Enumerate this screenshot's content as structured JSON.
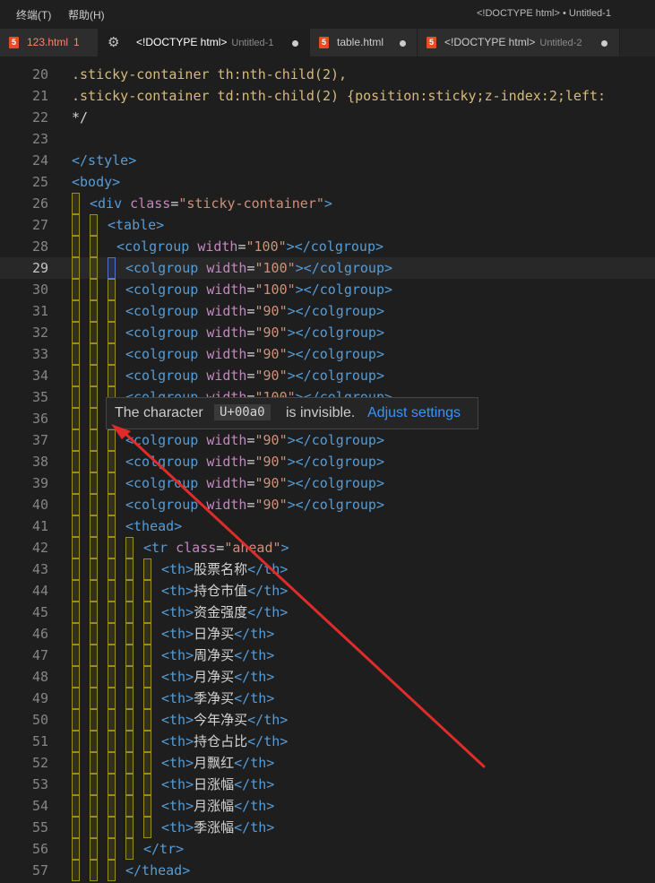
{
  "menu": [
    "终端(T)",
    "帮助(H)"
  ],
  "window_title": "<!DOCTYPE html> • Untitled-1",
  "tabs": [
    {
      "label": "123.html",
      "count": "1",
      "desc": "",
      "modified": false,
      "active": false,
      "icon": "html5-icon"
    },
    {
      "label": "<!DOCTYPE html>",
      "count": "",
      "desc": "Untitled-1",
      "modified": true,
      "active": true,
      "icon": "gear-icon"
    },
    {
      "label": "table.html",
      "count": "",
      "desc": "",
      "modified": true,
      "active": false,
      "icon": "html5-icon"
    },
    {
      "label": "<!DOCTYPE html>",
      "count": "",
      "desc": "Untitled-2",
      "modified": true,
      "active": false,
      "icon": "html5-icon"
    }
  ],
  "colors": {
    "guide": "#9a8d1c",
    "active_guide": "#4e73c8",
    "arrow": "#e02b2b"
  },
  "lines": [
    {
      "n": "20",
      "indent": 0,
      "cur": false,
      "guides": 0,
      "tokens": [
        {
          "t": ".sticky-container th:nth-child(2),",
          "c": "t-sel"
        }
      ]
    },
    {
      "n": "21",
      "indent": 0,
      "cur": false,
      "guides": 0,
      "tokens": [
        {
          "t": ".sticky-container td:nth-child(2) {position:sticky;z-index:2;left:",
          "c": "t-sel"
        }
      ]
    },
    {
      "n": "22",
      "indent": 0,
      "cur": false,
      "guides": 0,
      "tokens": [
        {
          "t": "*/",
          "c": "t-txt"
        }
      ]
    },
    {
      "n": "23",
      "indent": 0,
      "cur": false,
      "guides": 0,
      "tokens": []
    },
    {
      "n": "24",
      "indent": 0,
      "cur": false,
      "guides": 0,
      "tokens": [
        {
          "t": "</style>",
          "c": "t-tag"
        }
      ]
    },
    {
      "n": "25",
      "indent": 0,
      "cur": false,
      "guides": 0,
      "tokens": [
        {
          "t": "<body>",
          "c": "t-tag"
        }
      ]
    },
    {
      "n": "26",
      "indent": 20,
      "cur": false,
      "guides": 1,
      "tokens": [
        {
          "t": "<div ",
          "c": "t-tag"
        },
        {
          "t": "class",
          "c": "t-attr"
        },
        {
          "t": "=",
          "c": "t-txt"
        },
        {
          "t": "\"sticky-container\"",
          "c": "t-str"
        },
        {
          "t": ">",
          "c": "t-tag"
        }
      ]
    },
    {
      "n": "27",
      "indent": 40,
      "cur": false,
      "guides": 2,
      "tokens": [
        {
          "t": "<table>",
          "c": "t-tag"
        }
      ]
    },
    {
      "n": "28",
      "indent": 50,
      "cur": false,
      "guides": 2,
      "tokens": [
        {
          "t": "<colgroup ",
          "c": "t-tag"
        },
        {
          "t": "width",
          "c": "t-attr"
        },
        {
          "t": "=",
          "c": "t-txt"
        },
        {
          "t": "\"100\"",
          "c": "t-str"
        },
        {
          "t": "></colgroup>",
          "c": "t-tag"
        }
      ]
    },
    {
      "n": "29",
      "indent": 60,
      "cur": true,
      "guides": 3,
      "tokens": [
        {
          "t": "<colgroup ",
          "c": "t-tag"
        },
        {
          "t": "width",
          "c": "t-attr"
        },
        {
          "t": "=",
          "c": "t-txt"
        },
        {
          "t": "\"100\"",
          "c": "t-str"
        },
        {
          "t": "></colgroup>",
          "c": "t-tag"
        }
      ]
    },
    {
      "n": "30",
      "indent": 60,
      "cur": false,
      "guides": 3,
      "tokens": [
        {
          "t": "<colgroup ",
          "c": "t-tag"
        },
        {
          "t": "width",
          "c": "t-attr"
        },
        {
          "t": "=",
          "c": "t-txt"
        },
        {
          "t": "\"100\"",
          "c": "t-str"
        },
        {
          "t": "></colgroup>",
          "c": "t-tag"
        }
      ]
    },
    {
      "n": "31",
      "indent": 60,
      "cur": false,
      "guides": 3,
      "tokens": [
        {
          "t": "<colgroup ",
          "c": "t-tag"
        },
        {
          "t": "width",
          "c": "t-attr"
        },
        {
          "t": "=",
          "c": "t-txt"
        },
        {
          "t": "\"90\"",
          "c": "t-str"
        },
        {
          "t": "></colgroup>",
          "c": "t-tag"
        }
      ]
    },
    {
      "n": "32",
      "indent": 60,
      "cur": false,
      "guides": 3,
      "tokens": [
        {
          "t": "<colgroup ",
          "c": "t-tag"
        },
        {
          "t": "width",
          "c": "t-attr"
        },
        {
          "t": "=",
          "c": "t-txt"
        },
        {
          "t": "\"90\"",
          "c": "t-str"
        },
        {
          "t": "></colgroup>",
          "c": "t-tag"
        }
      ]
    },
    {
      "n": "33",
      "indent": 60,
      "cur": false,
      "guides": 3,
      "tokens": [
        {
          "t": "<colgroup ",
          "c": "t-tag"
        },
        {
          "t": "width",
          "c": "t-attr"
        },
        {
          "t": "=",
          "c": "t-txt"
        },
        {
          "t": "\"90\"",
          "c": "t-str"
        },
        {
          "t": "></colgroup>",
          "c": "t-tag"
        }
      ]
    },
    {
      "n": "34",
      "indent": 60,
      "cur": false,
      "guides": 3,
      "tokens": [
        {
          "t": "<colgroup ",
          "c": "t-tag"
        },
        {
          "t": "width",
          "c": "t-attr"
        },
        {
          "t": "=",
          "c": "t-txt"
        },
        {
          "t": "\"90\"",
          "c": "t-str"
        },
        {
          "t": "></colgroup>",
          "c": "t-tag"
        }
      ]
    },
    {
      "n": "35",
      "indent": 60,
      "cur": false,
      "guides": 3,
      "tokens": [
        {
          "t": "<colgroup ",
          "c": "t-tag"
        },
        {
          "t": "width",
          "c": "t-attr"
        },
        {
          "t": "=",
          "c": "t-txt"
        },
        {
          "t": "\"100\"",
          "c": "t-str"
        },
        {
          "t": "></colgroup>",
          "c": "t-tag"
        }
      ]
    },
    {
      "n": "36",
      "indent": 60,
      "cur": false,
      "guides": 3,
      "tokens": []
    },
    {
      "n": "37",
      "indent": 60,
      "cur": false,
      "guides": 3,
      "tokens": [
        {
          "t": "<colgroup ",
          "c": "t-tag"
        },
        {
          "t": "width",
          "c": "t-attr"
        },
        {
          "t": "=",
          "c": "t-txt"
        },
        {
          "t": "\"90\"",
          "c": "t-str"
        },
        {
          "t": "></colgroup>",
          "c": "t-tag"
        }
      ]
    },
    {
      "n": "38",
      "indent": 60,
      "cur": false,
      "guides": 3,
      "tokens": [
        {
          "t": "<colgroup ",
          "c": "t-tag"
        },
        {
          "t": "width",
          "c": "t-attr"
        },
        {
          "t": "=",
          "c": "t-txt"
        },
        {
          "t": "\"90\"",
          "c": "t-str"
        },
        {
          "t": "></colgroup>",
          "c": "t-tag"
        }
      ]
    },
    {
      "n": "39",
      "indent": 60,
      "cur": false,
      "guides": 3,
      "tokens": [
        {
          "t": "<colgroup ",
          "c": "t-tag"
        },
        {
          "t": "width",
          "c": "t-attr"
        },
        {
          "t": "=",
          "c": "t-txt"
        },
        {
          "t": "\"90\"",
          "c": "t-str"
        },
        {
          "t": "></colgroup>",
          "c": "t-tag"
        }
      ]
    },
    {
      "n": "40",
      "indent": 60,
      "cur": false,
      "guides": 3,
      "tokens": [
        {
          "t": "<colgroup ",
          "c": "t-tag"
        },
        {
          "t": "width",
          "c": "t-attr"
        },
        {
          "t": "=",
          "c": "t-txt"
        },
        {
          "t": "\"90\"",
          "c": "t-str"
        },
        {
          "t": "></colgroup>",
          "c": "t-tag"
        }
      ]
    },
    {
      "n": "41",
      "indent": 60,
      "cur": false,
      "guides": 3,
      "tokens": [
        {
          "t": "<thead>",
          "c": "t-tag"
        }
      ]
    },
    {
      "n": "42",
      "indent": 80,
      "cur": false,
      "guides": 4,
      "tokens": [
        {
          "t": "<tr ",
          "c": "t-tag"
        },
        {
          "t": "class",
          "c": "t-attr"
        },
        {
          "t": "=",
          "c": "t-txt"
        },
        {
          "t": "\"ahead\"",
          "c": "t-str"
        },
        {
          "t": ">",
          "c": "t-tag"
        }
      ]
    },
    {
      "n": "43",
      "indent": 100,
      "cur": false,
      "guides": 5,
      "tokens": [
        {
          "t": "<th>",
          "c": "t-tag"
        },
        {
          "t": "股票名称",
          "c": "t-txt"
        },
        {
          "t": "</th>",
          "c": "t-tag"
        }
      ]
    },
    {
      "n": "44",
      "indent": 100,
      "cur": false,
      "guides": 5,
      "tokens": [
        {
          "t": "<th>",
          "c": "t-tag"
        },
        {
          "t": "持仓市值",
          "c": "t-txt"
        },
        {
          "t": "</th>",
          "c": "t-tag"
        }
      ]
    },
    {
      "n": "45",
      "indent": 100,
      "cur": false,
      "guides": 5,
      "tokens": [
        {
          "t": "<th>",
          "c": "t-tag"
        },
        {
          "t": "资金强度",
          "c": "t-txt"
        },
        {
          "t": "</th>",
          "c": "t-tag"
        }
      ]
    },
    {
      "n": "46",
      "indent": 100,
      "cur": false,
      "guides": 5,
      "tokens": [
        {
          "t": "<th>",
          "c": "t-tag"
        },
        {
          "t": "日净买",
          "c": "t-txt"
        },
        {
          "t": "</th>",
          "c": "t-tag"
        }
      ]
    },
    {
      "n": "47",
      "indent": 100,
      "cur": false,
      "guides": 5,
      "tokens": [
        {
          "t": "<th>",
          "c": "t-tag"
        },
        {
          "t": "周净买",
          "c": "t-txt"
        },
        {
          "t": "</th>",
          "c": "t-tag"
        }
      ]
    },
    {
      "n": "48",
      "indent": 100,
      "cur": false,
      "guides": 5,
      "tokens": [
        {
          "t": "<th>",
          "c": "t-tag"
        },
        {
          "t": "月净买",
          "c": "t-txt"
        },
        {
          "t": "</th>",
          "c": "t-tag"
        }
      ]
    },
    {
      "n": "49",
      "indent": 100,
      "cur": false,
      "guides": 5,
      "tokens": [
        {
          "t": "<th>",
          "c": "t-tag"
        },
        {
          "t": "季净买",
          "c": "t-txt"
        },
        {
          "t": "</th>",
          "c": "t-tag"
        }
      ]
    },
    {
      "n": "50",
      "indent": 100,
      "cur": false,
      "guides": 5,
      "tokens": [
        {
          "t": "<th>",
          "c": "t-tag"
        },
        {
          "t": "今年净买",
          "c": "t-txt"
        },
        {
          "t": "</th>",
          "c": "t-tag"
        }
      ]
    },
    {
      "n": "51",
      "indent": 100,
      "cur": false,
      "guides": 5,
      "tokens": [
        {
          "t": "<th>",
          "c": "t-tag"
        },
        {
          "t": "持仓占比",
          "c": "t-txt"
        },
        {
          "t": "</th>",
          "c": "t-tag"
        }
      ]
    },
    {
      "n": "52",
      "indent": 100,
      "cur": false,
      "guides": 5,
      "tokens": [
        {
          "t": "<th>",
          "c": "t-tag"
        },
        {
          "t": "月飘红",
          "c": "t-txt"
        },
        {
          "t": "</th>",
          "c": "t-tag"
        }
      ]
    },
    {
      "n": "53",
      "indent": 100,
      "cur": false,
      "guides": 5,
      "tokens": [
        {
          "t": "<th>",
          "c": "t-tag"
        },
        {
          "t": "日涨幅",
          "c": "t-txt"
        },
        {
          "t": "</th>",
          "c": "t-tag"
        }
      ]
    },
    {
      "n": "54",
      "indent": 100,
      "cur": false,
      "guides": 5,
      "tokens": [
        {
          "t": "<th>",
          "c": "t-tag"
        },
        {
          "t": "月涨幅",
          "c": "t-txt"
        },
        {
          "t": "</th>",
          "c": "t-tag"
        }
      ]
    },
    {
      "n": "55",
      "indent": 100,
      "cur": false,
      "guides": 5,
      "tokens": [
        {
          "t": "<th>",
          "c": "t-tag"
        },
        {
          "t": "季涨幅",
          "c": "t-txt"
        },
        {
          "t": "</th>",
          "c": "t-tag"
        }
      ]
    },
    {
      "n": "56",
      "indent": 80,
      "cur": false,
      "guides": 4,
      "tokens": [
        {
          "t": "</tr>",
          "c": "t-tag"
        }
      ]
    },
    {
      "n": "57",
      "indent": 60,
      "cur": false,
      "guides": 3,
      "tokens": [
        {
          "t": "</thead>",
          "c": "t-tag"
        }
      ]
    }
  ],
  "hover": {
    "before": "The character",
    "code": "U+00a0",
    "middle": "is invisible.",
    "link": "Adjust settings"
  }
}
